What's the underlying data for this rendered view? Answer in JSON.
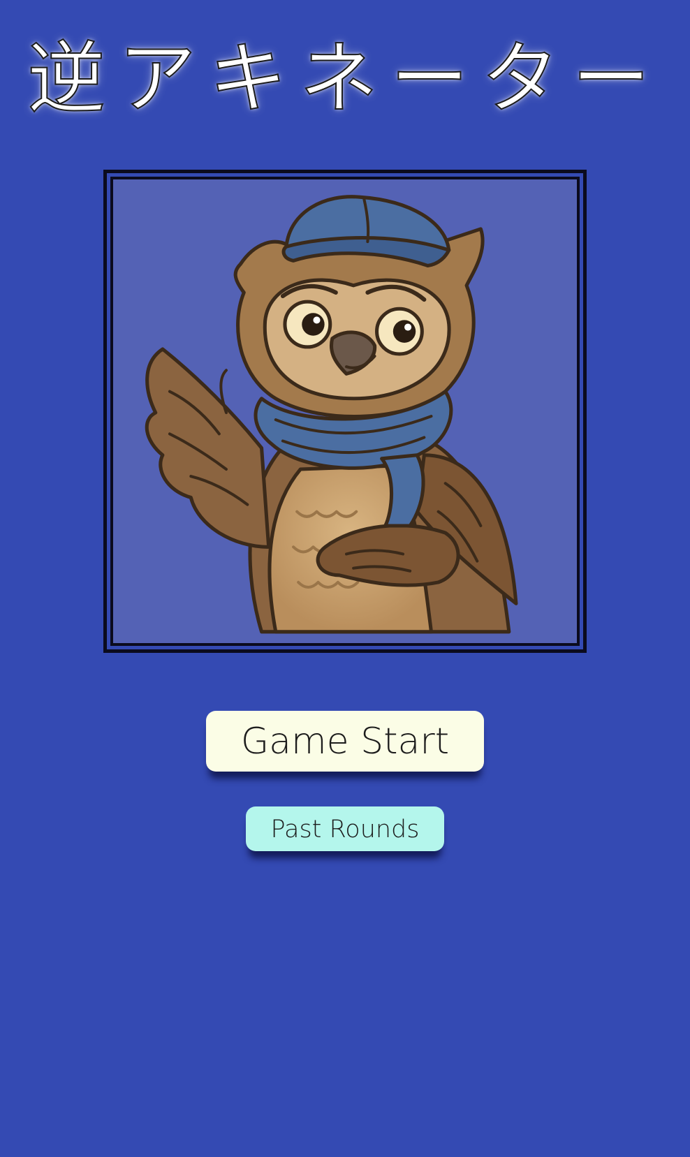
{
  "app": {
    "title": "逆アキネーター"
  },
  "hero": {
    "image_subject": "owl-icon",
    "frame_color": "#0b0b1e",
    "image_background": "#5462b5"
  },
  "menu": {
    "start_label": "Game Start",
    "history_label": "Past Rounds"
  },
  "colors": {
    "background": "#344ab3",
    "start_button": "#fbfde6",
    "history_button": "#b4f6ec",
    "text": "#1c1c1c"
  }
}
